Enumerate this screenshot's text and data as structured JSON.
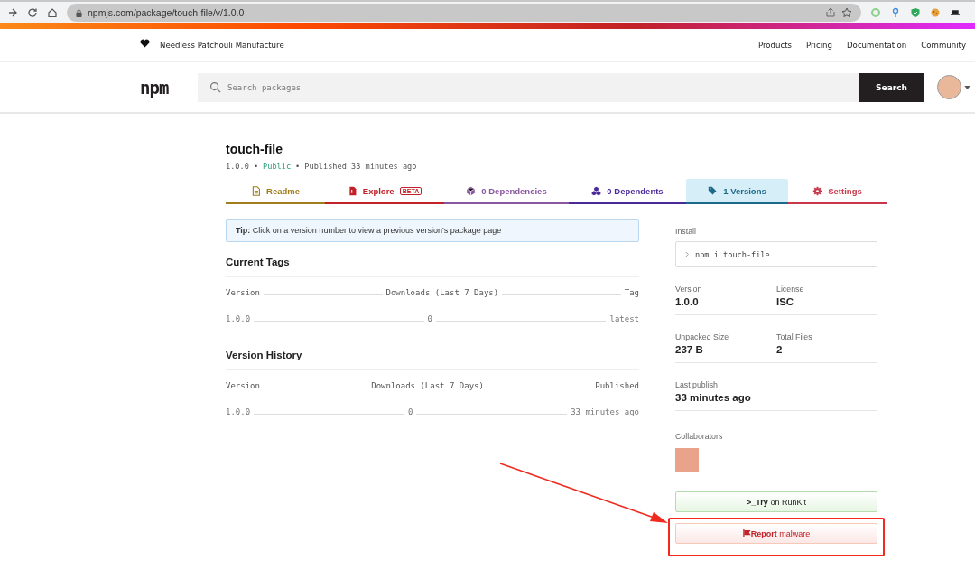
{
  "browser": {
    "url": "npmjs.com/package/touch-file/v/1.0.0"
  },
  "header": {
    "tagline": "Needless Patchouli Manufacture",
    "nav": [
      "Products",
      "Pricing",
      "Documentation",
      "Community"
    ],
    "logo": "npm",
    "search_placeholder": "Search packages",
    "search_button": "Search"
  },
  "package": {
    "name": "touch-file",
    "separator": "•",
    "version": "1.0.0",
    "visibility": "Public",
    "published": "Published 33 minutes ago"
  },
  "tabs": [
    {
      "kind": "readme",
      "label": "Readme",
      "color": "#a07c1a",
      "selected": false
    },
    {
      "kind": "explore",
      "label": "Explore",
      "badge": "BETA",
      "color": "#c12127",
      "selected": false
    },
    {
      "kind": "dependencies",
      "label": "0 Dependencies",
      "color": "#8956a0",
      "selected": false
    },
    {
      "kind": "dependents",
      "label": "0 Dependents",
      "color": "#4a2a99",
      "selected": false
    },
    {
      "kind": "versions",
      "label": "1 Versions",
      "color": "#1b6a8a",
      "selected": true
    },
    {
      "kind": "settings",
      "label": "Settings",
      "color": "#c8374b",
      "selected": false
    }
  ],
  "tip": "**Tip:** Click on a version number to view a previous version's package page",
  "sections": [
    {
      "title": "Current Tags",
      "columns": [
        "Version",
        "Downloads (Last 7 Days)",
        "Tag"
      ],
      "rows": [
        [
          "1.0.0",
          "0",
          "latest"
        ]
      ]
    },
    {
      "title": "Version History",
      "columns": [
        "Version",
        "Downloads (Last 7 Days)",
        "Published"
      ],
      "rows": [
        [
          "1.0.0",
          "0",
          "33 minutes ago"
        ]
      ]
    }
  ],
  "sidebar": {
    "install_label": "Install",
    "install_command": "npm i touch-file",
    "stats": [
      [
        {
          "label": "Version",
          "value": "1.0.0"
        },
        {
          "label": "License",
          "value": "ISC"
        }
      ],
      [
        {
          "label": "Unpacked Size",
          "value": "237 B"
        },
        {
          "label": "Total Files",
          "value": "2"
        }
      ],
      [
        {
          "label": "Last publish",
          "value": "33 minutes ago"
        }
      ]
    ],
    "collaborators_label": "Collaborators",
    "runkit_button": "**>_Try** on RunKit",
    "report_button": "**Report** malware"
  }
}
